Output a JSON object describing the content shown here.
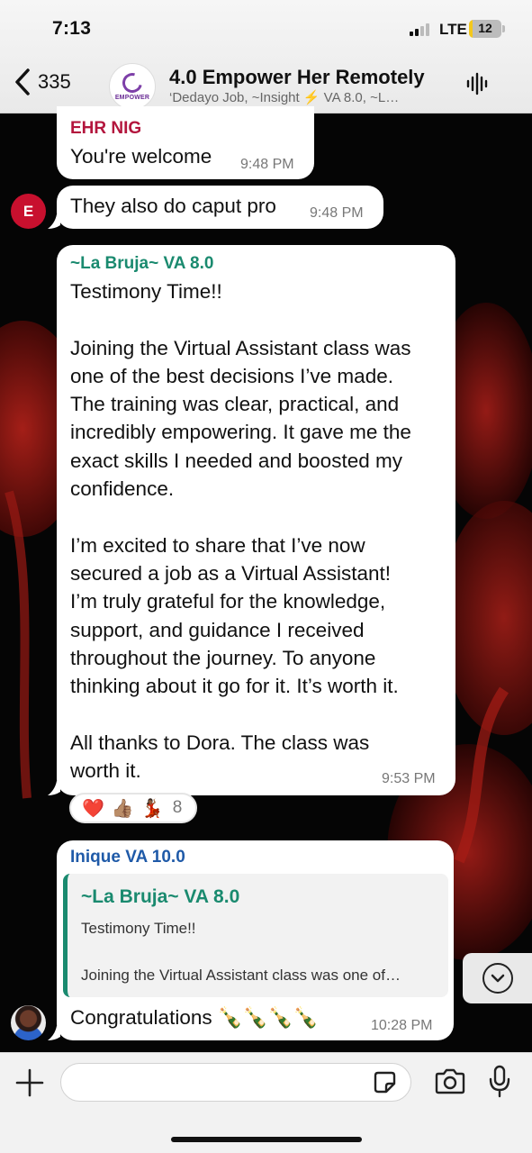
{
  "status_bar": {
    "time": "7:13",
    "network": "LTE",
    "battery": "12",
    "battery_level": 0.12
  },
  "header": {
    "back_count": "335",
    "group_name": "4.0 Empower Her Remotely",
    "members": "‘Dedayo Job, ~Insight ⚡ VA 8.0, ~L…",
    "avatar_text": "EMPOWER"
  },
  "messages": [
    {
      "sender": "EHR NIG",
      "text": "You're welcome",
      "time": "9:48 PM",
      "sender_color": "#b3153d"
    },
    {
      "text": "They also do caput pro",
      "time": "9:48 PM",
      "avatar_letter": "E"
    },
    {
      "sender": "~La Bruja~ VA 8.0",
      "sender_color": "#1a8a6f",
      "text": "Testimony Time!!\n\nJoining the Virtual Assistant class was\none of the best decisions I’ve made.\nThe training was clear, practical, and\nincredibly empowering. It gave me the\nexact skills I needed and boosted my\nconfidence.\n\nI’m excited to share that I’ve now\nsecured a job as a Virtual Assistant!\nI’m truly grateful for the knowledge,\nsupport, and guidance I received\nthroughout the journey. To anyone\nthinking about it go for it. It’s worth it.\n\nAll thanks to Dora. The class was\nworth it.",
      "time": "9:53 PM",
      "reactions": {
        "emojis": [
          "❤️",
          "👍🏽",
          "💃🏾"
        ],
        "count": "8"
      }
    },
    {
      "sender": "Inique VA 10.0",
      "sender_color": "#1f5aa8",
      "quote": {
        "sender": "~La Bruja~ VA 8.0",
        "text": "Testimony Time!!\n\nJoining the Virtual Assistant class was one of…"
      },
      "text": "Congratulations 🍾🍾🍾🍾",
      "time": "10:28 PM"
    }
  ],
  "composer": {
    "placeholder": ""
  },
  "icons": {
    "back": "chevron-left-icon",
    "voice": "audio-waveform-icon",
    "scroll": "chevron-down-icon",
    "plus": "plus-icon",
    "sticker": "sticker-icon",
    "camera": "camera-icon",
    "mic": "microphone-icon"
  },
  "colors": {
    "bubble": "#ffffff",
    "chat_bg": "#050505",
    "accent_green": "#1a8a6f",
    "ehr_red": "#b3153d",
    "avatar_red": "#c8102e"
  }
}
